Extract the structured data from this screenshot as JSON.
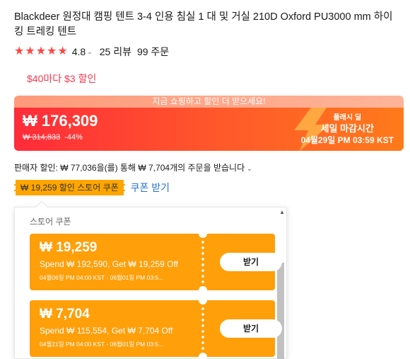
{
  "product": {
    "title": "Blackdeer 원정대 캠핑 텐트 3-4 인용 침실 1 대 및 거실 210D Oxford PU3000 mm 하이킹 트레킹 텐트",
    "rating": "4.8",
    "reviews": "25 리뷰",
    "orders": "99 주문",
    "stars": 5
  },
  "promo": {
    "text": "$40마다 $3 할인"
  },
  "flash": {
    "banner": "지금 쇼핑하고 할인 더 받으세요!",
    "price": "₩ 176,309",
    "old_price": "₩ 314,833",
    "discount": "-44%",
    "label": "플래시 딜",
    "deadline_label": "세일 마감시간",
    "deadline": "04월29일 PM 03:59 KST"
  },
  "seller": {
    "text": "판매자 할인: ₩ 77,036을(를) 통해 ₩ 7,704개의 주문을 받습니다"
  },
  "coupon_bar": {
    "tag": "₩ 19,259 할인 스토어 쿠폰",
    "link": "쿠폰 받기"
  },
  "popup": {
    "title": "스토어 쿠폰",
    "coupons": [
      {
        "amount": "₩ 19,259",
        "desc": "Spend ₩ 192,590, Get ₩ 19,259 Off",
        "date": "04월06일 PM 04:00 KST - 06월01일 PM 03:5...",
        "button": "받기"
      },
      {
        "amount": "₩ 7,704",
        "desc": "Spend ₩ 115,554, Get ₩ 7,704 Off",
        "date": "04월21일 PM 04:00 KST - 06월01일 PM 03:5...",
        "button": "받기"
      }
    ]
  },
  "colors": {
    "accent": "#ff4747",
    "coupon": "#ff9f0a",
    "link": "#2673d4"
  }
}
